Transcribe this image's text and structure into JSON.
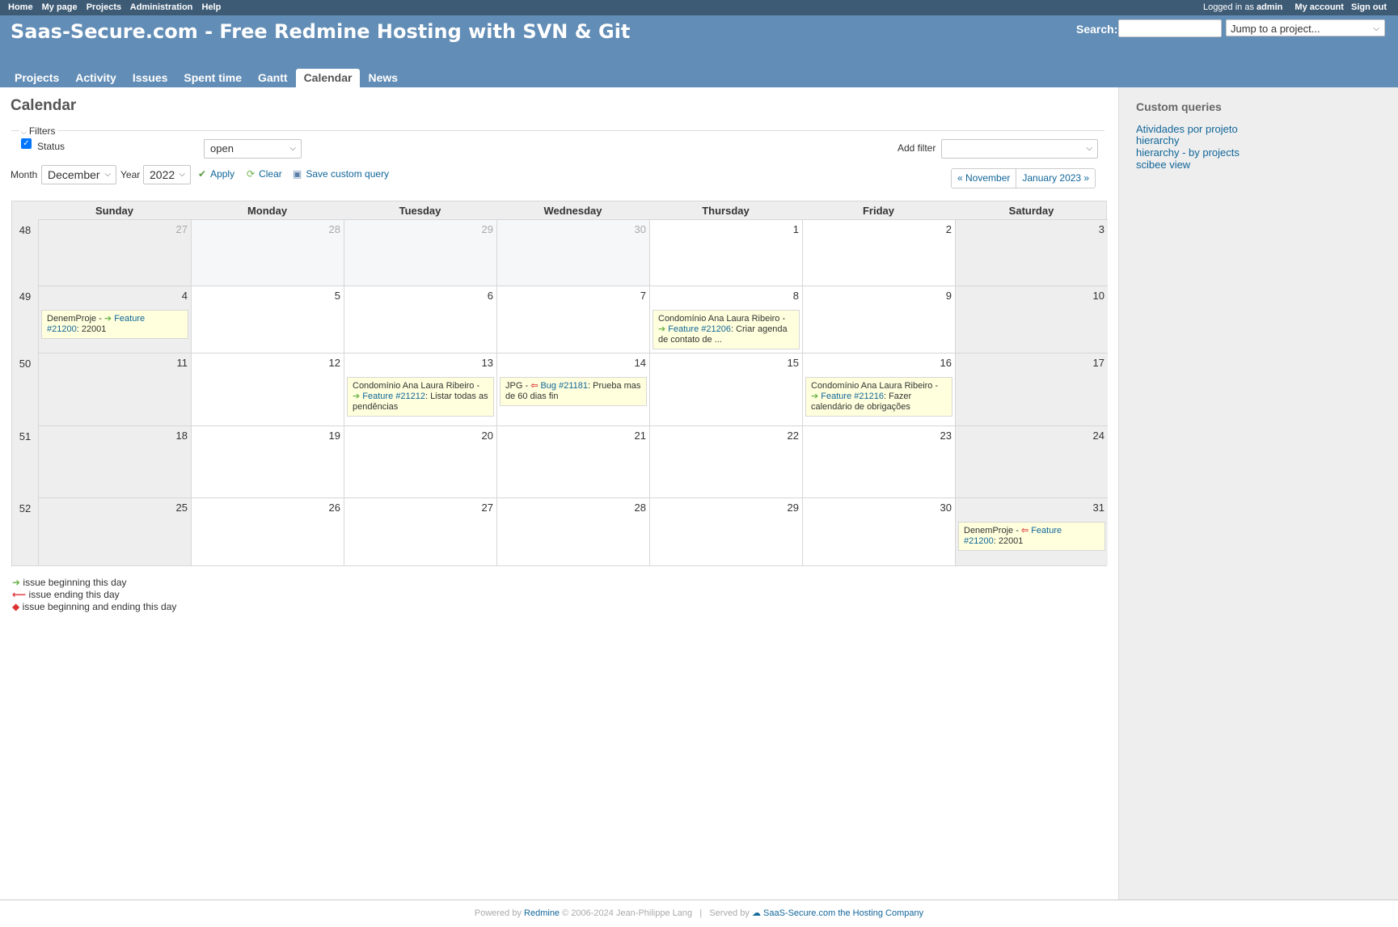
{
  "top_menu": {
    "left": [
      "Home",
      "My page",
      "Projects",
      "Administration",
      "Help"
    ],
    "logged_in_prefix": "Logged in as",
    "user": "admin",
    "my_account": "My account",
    "sign_out": "Sign out"
  },
  "header": {
    "site_title": "Saas-Secure.com - Free Redmine Hosting with SVN & Git",
    "search_label": "Search:",
    "jump_placeholder": "Jump to a project..."
  },
  "main_menu": [
    "Projects",
    "Activity",
    "Issues",
    "Spent time",
    "Gantt",
    "Calendar",
    "News"
  ],
  "main_menu_selected": "Calendar",
  "page": {
    "title": "Calendar",
    "filters_legend": "Filters",
    "status_label": "Status",
    "status_operator": "open",
    "add_filter_label": "Add filter",
    "month_label": "Month",
    "month_value": "December",
    "year_label": "Year",
    "year_value": "2022",
    "apply": "Apply",
    "clear": "Clear",
    "save_query": "Save custom query",
    "prev_month": "« November",
    "next_month": "January 2023 »"
  },
  "calendar": {
    "day_headers": [
      "Sunday",
      "Monday",
      "Tuesday",
      "Wednesday",
      "Thursday",
      "Friday",
      "Saturday"
    ],
    "weeks": [
      {
        "week": "48",
        "days": [
          "27",
          "28",
          "29",
          "30",
          "1",
          "2",
          "3"
        ],
        "other": [
          true,
          true,
          true,
          true,
          false,
          false,
          false
        ]
      },
      {
        "week": "49",
        "days": [
          "4",
          "5",
          "6",
          "7",
          "8",
          "9",
          "10"
        ],
        "other": [
          false,
          false,
          false,
          false,
          false,
          false,
          false
        ]
      },
      {
        "week": "50",
        "days": [
          "11",
          "12",
          "13",
          "14",
          "15",
          "16",
          "17"
        ],
        "other": [
          false,
          false,
          false,
          false,
          false,
          false,
          false
        ]
      },
      {
        "week": "51",
        "days": [
          "18",
          "19",
          "20",
          "21",
          "22",
          "23",
          "24"
        ],
        "other": [
          false,
          false,
          false,
          false,
          false,
          false,
          false
        ]
      },
      {
        "week": "52",
        "days": [
          "25",
          "26",
          "27",
          "28",
          "29",
          "30",
          "31"
        ],
        "other": [
          false,
          false,
          false,
          false,
          false,
          false,
          false
        ]
      }
    ],
    "issues": [
      {
        "week": 1,
        "day": 0,
        "project": "DenemProje",
        "arrow": "start",
        "tracker": "Feature",
        "line2": "#21200",
        "subject": ": 22001"
      },
      {
        "week": 1,
        "day": 4,
        "project": "Condomínio Ana Laura Ribeiro",
        "arrow": "start",
        "tracker": "Feature #21206",
        "line2": "",
        "subject": ": Criar agenda de contato de ..."
      },
      {
        "week": 2,
        "day": 2,
        "project": "Condomínio Ana Laura Ribeiro",
        "arrow": "start",
        "tracker": "Feature #21212",
        "line2": "",
        "subject": ": Listar todas as pendências"
      },
      {
        "week": 2,
        "day": 3,
        "project": "JPG",
        "arrow": "end",
        "tracker": "Bug #21181",
        "line2": "",
        "subject": ": Prueba mas de 60 dias fin"
      },
      {
        "week": 2,
        "day": 5,
        "project": "Condomínio Ana Laura Ribeiro",
        "arrow": "start",
        "tracker": "Feature #21216",
        "line2": "",
        "subject": ": Fazer calendário de obrigações"
      },
      {
        "week": 4,
        "day": 6,
        "project": "DenemProje",
        "arrow": "end",
        "tracker": "Feature",
        "line2": "#21200",
        "subject": ": 22001"
      }
    ]
  },
  "legend": [
    {
      "icon": "start",
      "text": "issue beginning this day"
    },
    {
      "icon": "end",
      "text": "issue ending this day"
    },
    {
      "icon": "both",
      "text": "issue beginning and ending this day"
    }
  ],
  "sidebar": {
    "title": "Custom queries",
    "queries": [
      "Atividades por projeto",
      "hierarchy",
      "hierarchy - by projects",
      "scibee view"
    ]
  },
  "footer": {
    "powered_by": "Powered by",
    "redmine": "Redmine",
    "copyright": "© 2006-2024 Jean-Philippe Lang",
    "separator": "|",
    "served_by": "Served by",
    "hoster": "SaaS-Secure.com the Hosting Company"
  },
  "colors": {
    "top_menu_bg": "#3e5b76",
    "header_bg": "#628db6",
    "link": "#169",
    "issue_bg": "#ffffdd",
    "arrow_start": "#6cb34a",
    "arrow_end": "#d33"
  }
}
